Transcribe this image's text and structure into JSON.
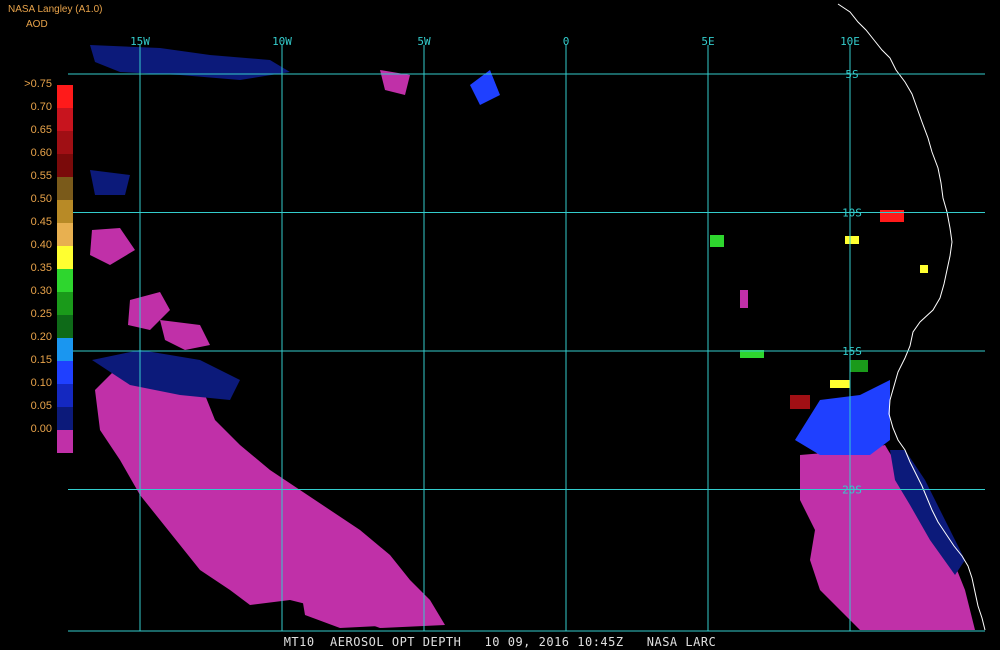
{
  "header": {
    "title": "NASA Langley (A1.0)",
    "variable": "AOD"
  },
  "footer": {
    "caption": "MT10  AEROSOL OPT DEPTH   10 09, 2016 10:45Z   NASA LARC"
  },
  "legend": {
    "items": [
      {
        "label": ">0.75",
        "color": "#ff1a1a"
      },
      {
        "label": "0.70",
        "color": "#c8141e"
      },
      {
        "label": "0.65",
        "color": "#a00f14"
      },
      {
        "label": "0.60",
        "color": "#7a0a0a"
      },
      {
        "label": "0.55",
        "color": "#7a5a1a"
      },
      {
        "label": "0.50",
        "color": "#b88a26"
      },
      {
        "label": "0.45",
        "color": "#e8b050"
      },
      {
        "label": "0.40",
        "color": "#ffff30"
      },
      {
        "label": "0.35",
        "color": "#2ed62e"
      },
      {
        "label": "0.30",
        "color": "#1a9a1a"
      },
      {
        "label": "0.25",
        "color": "#0e6a18"
      },
      {
        "label": "0.20",
        "color": "#1a96f0"
      },
      {
        "label": "0.15",
        "color": "#1f40ff"
      },
      {
        "label": "0.10",
        "color": "#1428c0"
      },
      {
        "label": "0.05",
        "color": "#0c1a7a"
      },
      {
        "label": "0.00",
        "color": "#c030a8"
      }
    ]
  },
  "grid": {
    "color": "#33cccc",
    "longitudes": [
      {
        "label": "15W",
        "value": -15
      },
      {
        "label": "10W",
        "value": -10
      },
      {
        "label": "5W",
        "value": -5
      },
      {
        "label": "0",
        "value": 0
      },
      {
        "label": "5E",
        "value": 5
      },
      {
        "label": "10E",
        "value": 10
      }
    ],
    "latitudes": [
      {
        "label": "5S",
        "value": -5
      },
      {
        "label": "10S",
        "value": -10
      },
      {
        "label": "15S",
        "value": -15
      },
      {
        "label": "20S",
        "value": -20
      }
    ]
  },
  "palette": {
    "background": "#000000",
    "coastline": "#ffffff",
    "low_aod": "#c030a8",
    "blue": "#1f40ff",
    "navy": "#0c1a7a"
  }
}
